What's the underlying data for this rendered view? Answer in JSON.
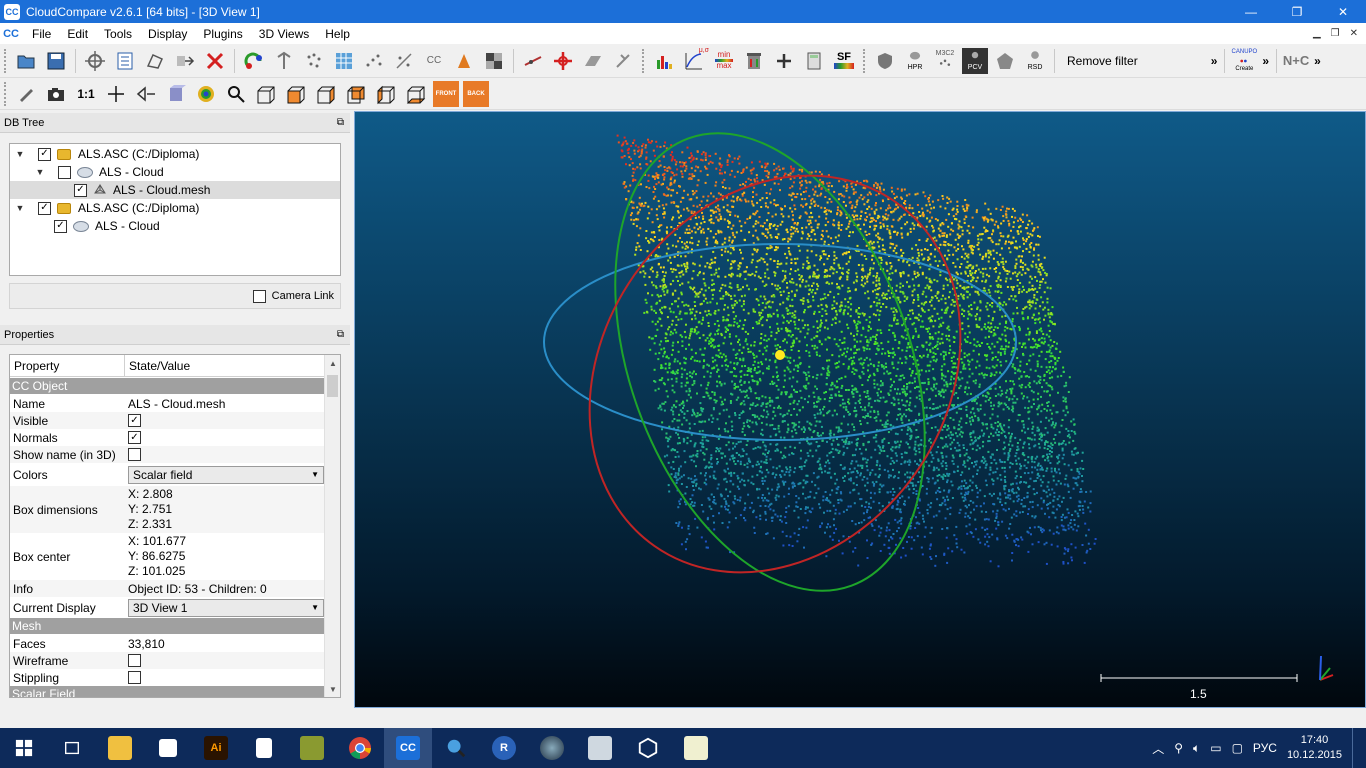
{
  "window": {
    "title": "CloudCompare v2.6.1 [64 bits] - [3D View 1]",
    "minimize": "—",
    "maximize": "❐",
    "close": "✕"
  },
  "menu": [
    "File",
    "Edit",
    "Tools",
    "Display",
    "Plugins",
    "3D Views",
    "Help"
  ],
  "toolbar": {
    "remove_filter": "Remove filter",
    "more": "»",
    "zoom_1to1": "1:1",
    "front_label": "FRONT",
    "back_label": "BACK",
    "sf_label": "SF",
    "minmax_top": "min",
    "minmax_bottom": "max",
    "mu_sigma": "μ,σ",
    "cc_label": "CC",
    "canupo_label": "CANUPO",
    "canupo_sub": "Create",
    "nc_label": "N+C",
    "hpr_label": "HPR",
    "m3c2_label": "M3C2",
    "pcv_label": "PCV",
    "rsd_label": "RSD"
  },
  "db_tree": {
    "header": "DB Tree",
    "items": [
      {
        "label": "ALS.ASC (C:/Diploma)",
        "checked": true,
        "type": "folder"
      },
      {
        "label": "ALS - Cloud",
        "checked": false,
        "type": "cloud"
      },
      {
        "label": "ALS - Cloud.mesh",
        "checked": true,
        "type": "mesh",
        "selected": true
      },
      {
        "label": "ALS.ASC (C:/Diploma)",
        "checked": true,
        "type": "folder"
      },
      {
        "label": "ALS - Cloud",
        "checked": true,
        "type": "cloud"
      }
    ],
    "camera_link": "Camera Link"
  },
  "properties": {
    "header": "Properties",
    "col_property": "Property",
    "col_value": "State/Value",
    "sections": {
      "cc_object": "CC Object",
      "mesh": "Mesh",
      "scalar_field": "Scalar Field"
    },
    "rows": {
      "name_k": "Name",
      "name_v": "ALS - Cloud.mesh",
      "visible_k": "Visible",
      "normals_k": "Normals",
      "showname_k": "Show name (in 3D)",
      "colors_k": "Colors",
      "colors_v": "Scalar field",
      "boxdim_k": "Box dimensions",
      "boxdim_x": "X: 2.808",
      "boxdim_y": "Y: 2.751",
      "boxdim_z": "Z: 2.331",
      "boxctr_k": "Box center",
      "boxctr_x": "X: 101.677",
      "boxctr_y": "Y: 86.6275",
      "boxctr_z": "Z: 101.025",
      "info_k": "Info",
      "info_v": "Object ID: 53 - Children: 0",
      "display_k": "Current Display",
      "display_v": "3D View 1",
      "faces_k": "Faces",
      "faces_v": "33,810",
      "wireframe_k": "Wireframe",
      "stippling_k": "Stippling"
    }
  },
  "view": {
    "scale_value": "1.5",
    "background_top": "#0f5a88",
    "background_bottom": "#01070d"
  },
  "taskbar": {
    "lang": "РУС",
    "time": "17:40",
    "date": "10.12.2015",
    "ai_label": "Ai",
    "r_label": "R",
    "cc_label": "CC"
  }
}
